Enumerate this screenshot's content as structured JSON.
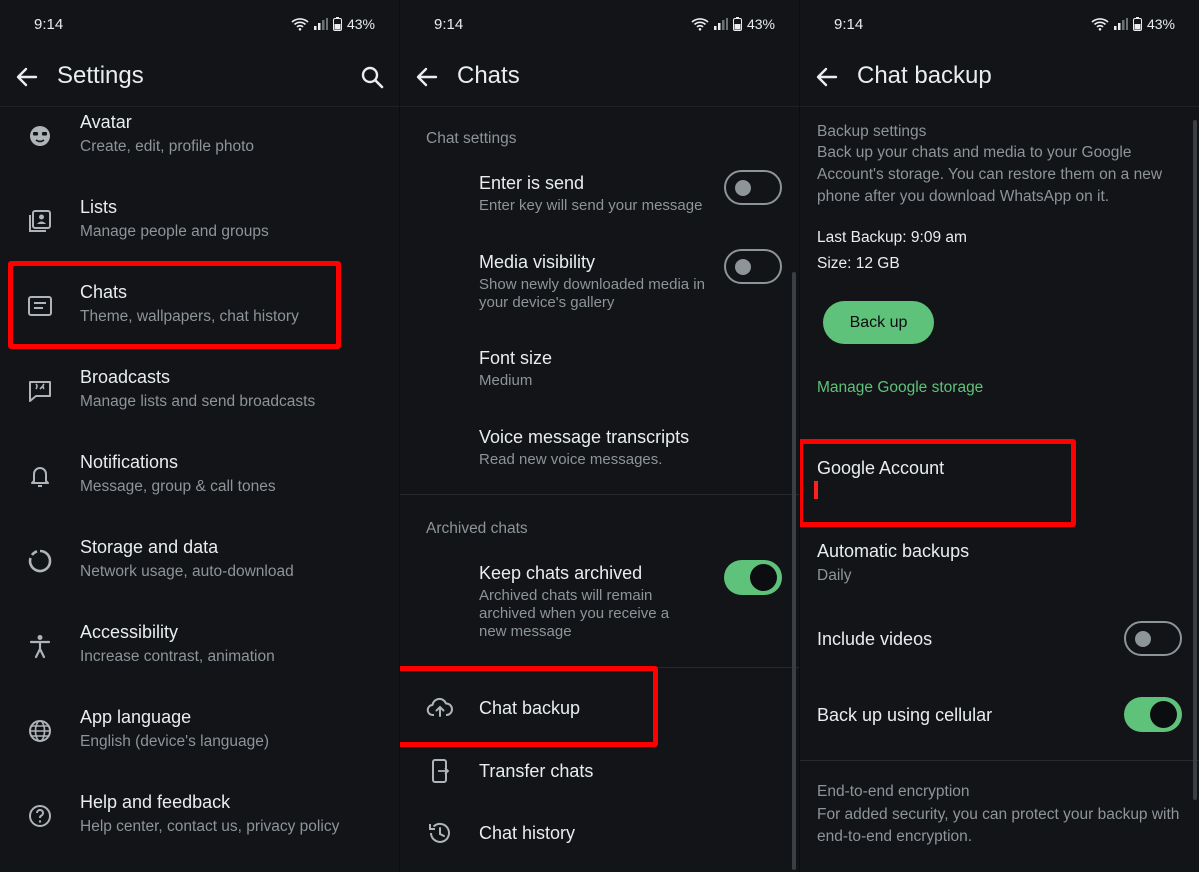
{
  "status": {
    "time": "9:14",
    "battery": "43%"
  },
  "settings": {
    "title": "Settings",
    "items": [
      {
        "title": "Avatar",
        "subtitle": "Create, edit, profile photo",
        "icon": "avatar-icon"
      },
      {
        "title": "Lists",
        "subtitle": "Manage people and groups",
        "icon": "lists-icon"
      },
      {
        "title": "Chats",
        "subtitle": "Theme, wallpapers, chat history",
        "icon": "chats-icon"
      },
      {
        "title": "Broadcasts",
        "subtitle": "Manage lists and send broadcasts",
        "icon": "broadcast-icon"
      },
      {
        "title": "Notifications",
        "subtitle": "Message, group & call tones",
        "icon": "bell-icon"
      },
      {
        "title": "Storage and data",
        "subtitle": "Network usage, auto-download",
        "icon": "storage-icon"
      },
      {
        "title": "Accessibility",
        "subtitle": "Increase contrast, animation",
        "icon": "accessibility-icon"
      },
      {
        "title": "App language",
        "subtitle": "English (device's language)",
        "icon": "globe-icon"
      },
      {
        "title": "Help and feedback",
        "subtitle": "Help center, contact us, privacy policy",
        "icon": "help-icon"
      }
    ]
  },
  "chats": {
    "title": "Chats",
    "section_chat_settings": "Chat settings",
    "enter_is_send": {
      "title": "Enter is send",
      "subtitle": "Enter key will send your message",
      "enabled": false
    },
    "media_visibility": {
      "title": "Media visibility",
      "subtitle": "Show newly downloaded media in your device's gallery",
      "enabled": false
    },
    "font_size": {
      "title": "Font size",
      "subtitle": "Medium"
    },
    "voice_transcripts": {
      "title": "Voice message transcripts",
      "subtitle": "Read new voice messages."
    },
    "section_archived": "Archived chats",
    "keep_archived": {
      "title": "Keep chats archived",
      "subtitle": "Archived chats will remain archived when you receive a new message",
      "enabled": true
    },
    "chat_backup": "Chat backup",
    "transfer_chats": "Transfer chats",
    "chat_history": "Chat history"
  },
  "backup": {
    "title": "Chat backup",
    "section_header": "Backup settings",
    "description": "Back up your chats and media to your Google Account's storage. You can restore them on a new phone after you download WhatsApp on it.",
    "last_backup": "Last Backup: 9:09 am",
    "size": "Size: 12 GB",
    "backup_button": "Back up",
    "manage_storage": "Manage Google storage",
    "google_account": "Google Account",
    "automatic_backups": {
      "title": "Automatic backups",
      "subtitle": "Daily"
    },
    "include_videos": {
      "title": "Include videos",
      "enabled": false
    },
    "cellular": {
      "title": "Back up using cellular",
      "enabled": true
    },
    "e2e": {
      "title": "End-to-end encryption",
      "subtitle": "For added security, you can protect your backup with end-to-end encryption."
    }
  },
  "colors": {
    "accent": "#5fc27a",
    "highlight": "#ff0000",
    "background": "#121417"
  }
}
